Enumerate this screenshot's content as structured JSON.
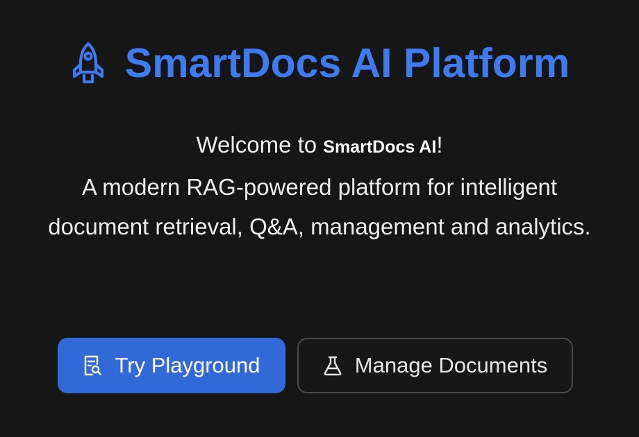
{
  "hero": {
    "title": "SmartDocs AI Platform",
    "logo_icon": "rocket-icon",
    "accent_color": "#3d7bee"
  },
  "intro": {
    "welcome_prefix": "Welcome to ",
    "brand": "SmartDocs AI",
    "welcome_suffix": "!",
    "description": "A modern RAG-powered platform for intelligent document retrieval, Q&A, management and analytics."
  },
  "actions": {
    "primary": {
      "label": "Try Playground",
      "icon": "document-search-icon",
      "color": "#3169d8"
    },
    "secondary": {
      "label": "Manage Documents",
      "icon": "flask-icon"
    }
  }
}
